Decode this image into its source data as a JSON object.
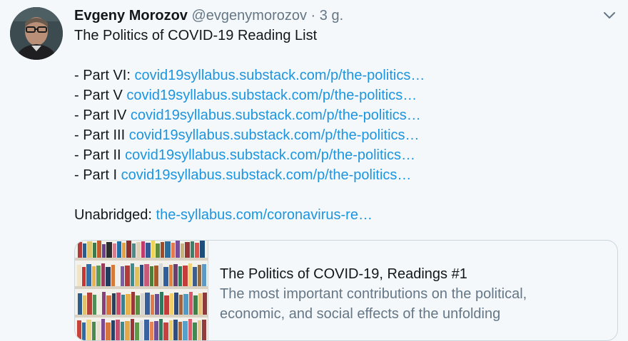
{
  "tweet": {
    "author_name": "Evgeny Morozov",
    "author_handle": "@evgenymorozov",
    "separator": "·",
    "time": "3 g.",
    "title_line": "The Politics of COVID-19 Reading List",
    "parts": [
      {
        "label": "- Part VI:",
        "link": "covid19syllabus.substack.com/p/the-politics…"
      },
      {
        "label": "- Part V",
        "link": "covid19syllabus.substack.com/p/the-politics…"
      },
      {
        "label": "- Part IV",
        "link": "covid19syllabus.substack.com/p/the-politics…"
      },
      {
        "label": "- Part III",
        "link": "covid19syllabus.substack.com/p/the-politics…"
      },
      {
        "label": "- Part II",
        "link": "covid19syllabus.substack.com/p/the-politics…"
      },
      {
        "label": "- Part I",
        "link": "covid19syllabus.substack.com/p/the-politics…"
      }
    ],
    "unabridged_label": "Unabridged:",
    "unabridged_link": "the-syllabus.com/coronavirus-re…"
  },
  "card": {
    "title": "The Politics of COVID-19, Readings #1",
    "description_line1": "The most important contributions on the political,",
    "description_line2": "economic, and social effects of the unfolding"
  },
  "icons": {
    "menu": "chevron-down-icon",
    "avatar": "avatar-photo",
    "card_image": "bookshelf-image"
  },
  "colors": {
    "background": "#f5f8fa",
    "link": "#1b95e0",
    "muted": "#657786",
    "border": "#ccd6dd"
  }
}
